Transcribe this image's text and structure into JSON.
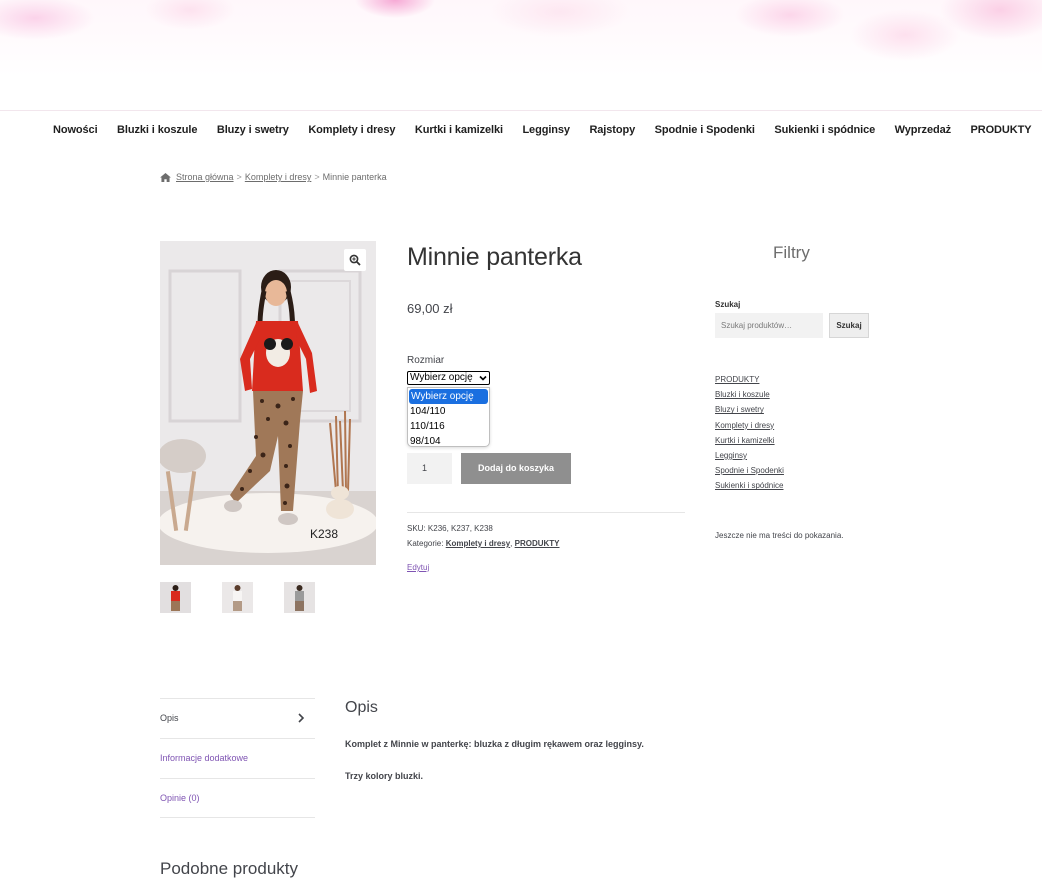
{
  "nav": {
    "items": [
      "Nowości",
      "Bluzki i koszule",
      "Bluzy i swetry",
      "Komplety i dresy",
      "Kurtki i kamizelki",
      "Legginsy",
      "Rajstopy",
      "Spodnie i Spodenki",
      "Sukienki i spódnice",
      "Wyprzedaż",
      "PRODUKTY"
    ]
  },
  "breadcrumb": {
    "home": "Strona główna",
    "separator": ">",
    "category": "Komplety i dresy",
    "current": "Minnie panterka"
  },
  "product": {
    "title": "Minnie panterka",
    "price": "69,00 zł",
    "image_label": "K238",
    "variation_label": "Rozmiar",
    "select_value": "Wybierz opcję",
    "options": [
      "Wybierz opcję",
      "104/110",
      "110/116",
      "98/104"
    ],
    "quantity": "1",
    "add_to_cart": "Dodaj do koszyka",
    "sku_label": "SKU:",
    "sku_value": "K236, K237, K238",
    "categories_label": "Kategorie:",
    "categories": [
      "Komplety i dresy",
      "PRODUKTY"
    ],
    "edit": "Edytuj"
  },
  "sidebar": {
    "title": "Filtry",
    "search_label": "Szukaj",
    "search_placeholder": "Szukaj produktów…",
    "search_button": "Szukaj",
    "categories": [
      "PRODUKTY",
      "Bluzki i koszule",
      "Bluzy i swetry",
      "Komplety i dresy",
      "Kurtki i kamizelki",
      "Legginsy",
      "Spodnie i Spodenki",
      "Sukienki i spódnice"
    ],
    "empty_note": "Jeszcze nie ma treści do pokazania."
  },
  "tabs": {
    "items": [
      "Opis",
      "Informacje dodatkowe",
      "Opinie (0)"
    ]
  },
  "description": {
    "title": "Opis",
    "p1": "Komplet z Minnie w panterkę: bluzka z długim rękawem oraz legginsy.",
    "p2": "Trzy kolory bluzki."
  },
  "related": {
    "title": "Podobne produkty"
  },
  "colors": {
    "accent_link": "#7f54b3",
    "button_gray": "#8f8f8f",
    "select_highlight": "#1a6fe0"
  }
}
